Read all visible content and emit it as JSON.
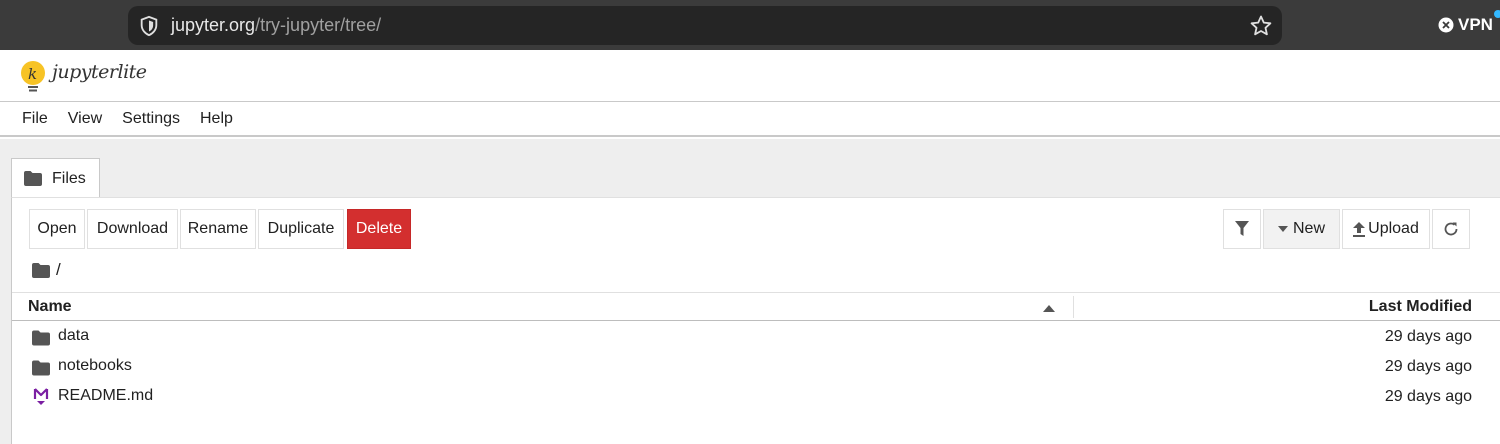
{
  "browser": {
    "url_host": "jupyter.org",
    "url_path": "/try-jupyter/tree/",
    "vpn_label": "VPN"
  },
  "header": {
    "logo_text": "jupyterlite"
  },
  "menu": {
    "items": [
      "File",
      "View",
      "Settings",
      "Help"
    ]
  },
  "tab": {
    "label": "Files"
  },
  "toolbar": {
    "open": "Open",
    "download": "Download",
    "rename": "Rename",
    "duplicate": "Duplicate",
    "delete": "Delete",
    "new": "New",
    "upload": "Upload"
  },
  "breadcrumb": {
    "path": "/"
  },
  "list": {
    "col_name": "Name",
    "col_modified": "Last Modified",
    "rows": [
      {
        "name": "data",
        "modified": "29 days ago",
        "icon": "folder-icon"
      },
      {
        "name": "notebooks",
        "modified": "29 days ago",
        "icon": "folder-icon"
      },
      {
        "name": "README.md",
        "modified": "29 days ago",
        "icon": "markdown-icon"
      }
    ]
  },
  "colors": {
    "delete_bg": "#d32f2f",
    "logo_yellow": "#f7c325",
    "markdown_purple": "#7b1fa2",
    "browser_chrome": "#3b3b3b"
  }
}
